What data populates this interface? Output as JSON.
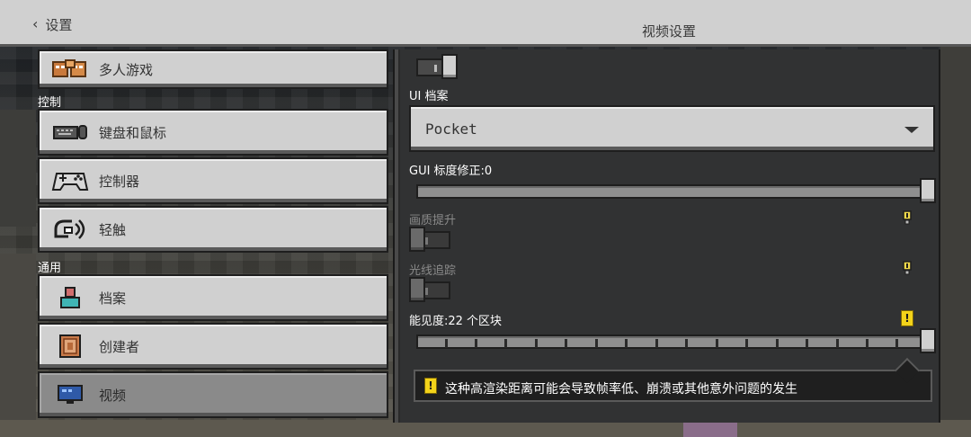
{
  "header": {
    "back_label": "设置",
    "title": "视频设置"
  },
  "sidebar": {
    "sections": [
      {
        "label": "控制"
      },
      {
        "label": "通用"
      }
    ],
    "items": [
      {
        "label": "多人游戏",
        "icon": "multiplayer-icon"
      },
      {
        "label": "键盘和鼠标",
        "icon": "keyboard-mouse-icon"
      },
      {
        "label": "控制器",
        "icon": "controller-icon"
      },
      {
        "label": "轻触",
        "icon": "touch-icon"
      },
      {
        "label": "档案",
        "icon": "profile-icon"
      },
      {
        "label": "创建者",
        "icon": "creator-icon"
      },
      {
        "label": "视频",
        "icon": "video-monitor-icon",
        "active": true
      }
    ]
  },
  "video_settings": {
    "top_toggle": {
      "state": "on"
    },
    "ui_profile": {
      "label": "UI 档案",
      "value": "Pocket"
    },
    "gui_scale": {
      "label": "GUI 标度修正:0",
      "value": 1.0
    },
    "upscaling": {
      "label": "画质提升",
      "state": "off",
      "icon": "lightbulb-icon"
    },
    "raytracing": {
      "label": "光线追踪",
      "state": "off",
      "icon": "lightbulb-icon"
    },
    "render_distance": {
      "label": "能见度:22 个区块",
      "value": 1.0,
      "icon": "warning-icon"
    },
    "warning": {
      "text": "这种高渲染距离可能会导致帧率低、崩溃或其他意外问题的发生"
    }
  },
  "colors": {
    "button_gray": "#d0d0d0",
    "active_gray": "#8a8a8a",
    "panel_dark": "#313233",
    "warning_yellow": "#f3d31a"
  }
}
